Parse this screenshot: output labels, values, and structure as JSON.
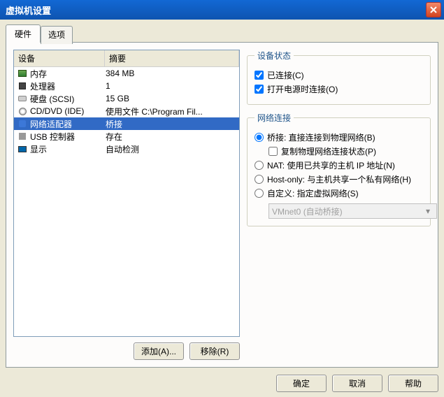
{
  "window": {
    "title": "虚拟机设置"
  },
  "tabs": {
    "hardware": "硬件",
    "options": "选项"
  },
  "columns": {
    "device": "设备",
    "summary": "摘要"
  },
  "devices": [
    {
      "name": "内存",
      "summary": "384 MB"
    },
    {
      "name": "处理器",
      "summary": "1"
    },
    {
      "name": "硬盘 (SCSI)",
      "summary": "15 GB"
    },
    {
      "name": "CD/DVD (IDE)",
      "summary": "使用文件 C:\\Program Fil..."
    },
    {
      "name": "网络适配器",
      "summary": "桥接"
    },
    {
      "name": "USB 控制器",
      "summary": "存在"
    },
    {
      "name": "显示",
      "summary": "自动检测"
    }
  ],
  "buttons": {
    "add": "添加(A)...",
    "remove": "移除(R)",
    "ok": "确定",
    "cancel": "取消",
    "help": "帮助"
  },
  "status": {
    "legend": "设备状态",
    "connected": "已连接(C)",
    "connectAtPowerOn": "打开电源时连接(O)"
  },
  "net": {
    "legend": "网络连接",
    "bridged": "桥接: 直接连接到物理网络(B)",
    "replicate": "复制物理网络连接状态(P)",
    "nat": "NAT: 使用已共享的主机 IP 地址(N)",
    "hostonly": "Host-only: 与主机共享一个私有网络(H)",
    "custom": "自定义: 指定虚拟网络(S)",
    "combo": "VMnet0 (自动桥接)"
  }
}
